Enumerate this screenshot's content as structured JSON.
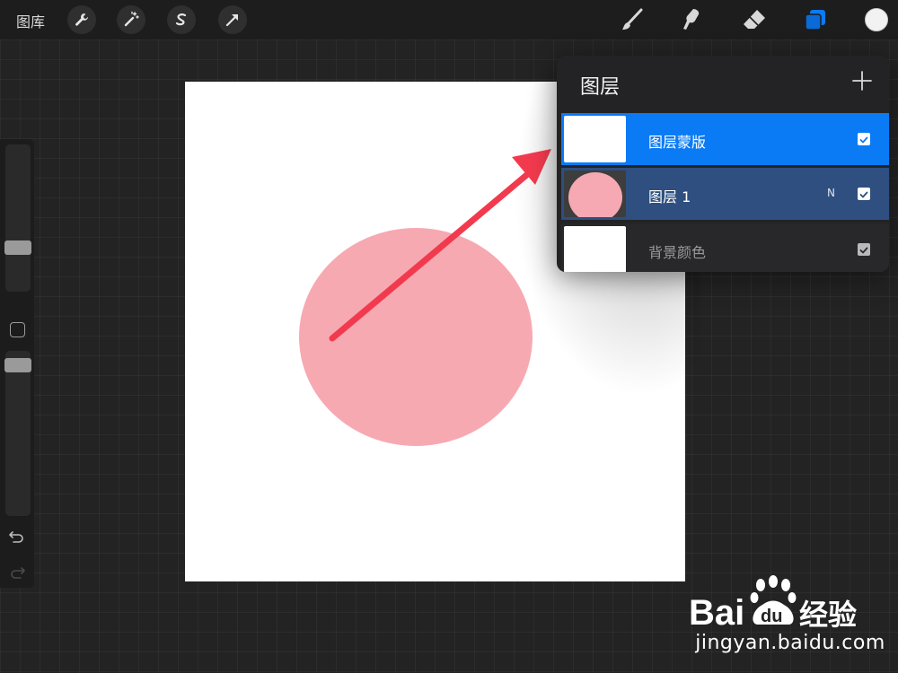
{
  "topbar": {
    "gallery_label": "图库",
    "tools_left": [
      "wrench-icon",
      "magic-wand-icon",
      "selection-s-icon",
      "move-arrow-icon"
    ],
    "tools_right": [
      "brush-icon",
      "smudge-icon",
      "eraser-icon",
      "layers-icon"
    ],
    "current_color": "#f2f2f2",
    "accent_color": "#0a7bf5"
  },
  "sidebar": {
    "brush_size_level": 0.28,
    "opacity_level": 0.95
  },
  "canvas": {
    "background": "#ffffff",
    "circle_color": "#f7a9b1",
    "annotation_arrow_color": "#f23a4e"
  },
  "layers_panel": {
    "title": "图层",
    "layers": [
      {
        "name": "图层蒙版",
        "blend": "",
        "visible": true,
        "thumb": "white"
      },
      {
        "name": "图层 1",
        "blend": "N",
        "visible": true,
        "thumb": "pink-circle"
      },
      {
        "name": "背景颜色",
        "blend": "",
        "visible": true,
        "thumb": "white"
      }
    ]
  },
  "watermark": {
    "logo_text": "Baidu经验",
    "url": "jingyan.baidu.com"
  }
}
